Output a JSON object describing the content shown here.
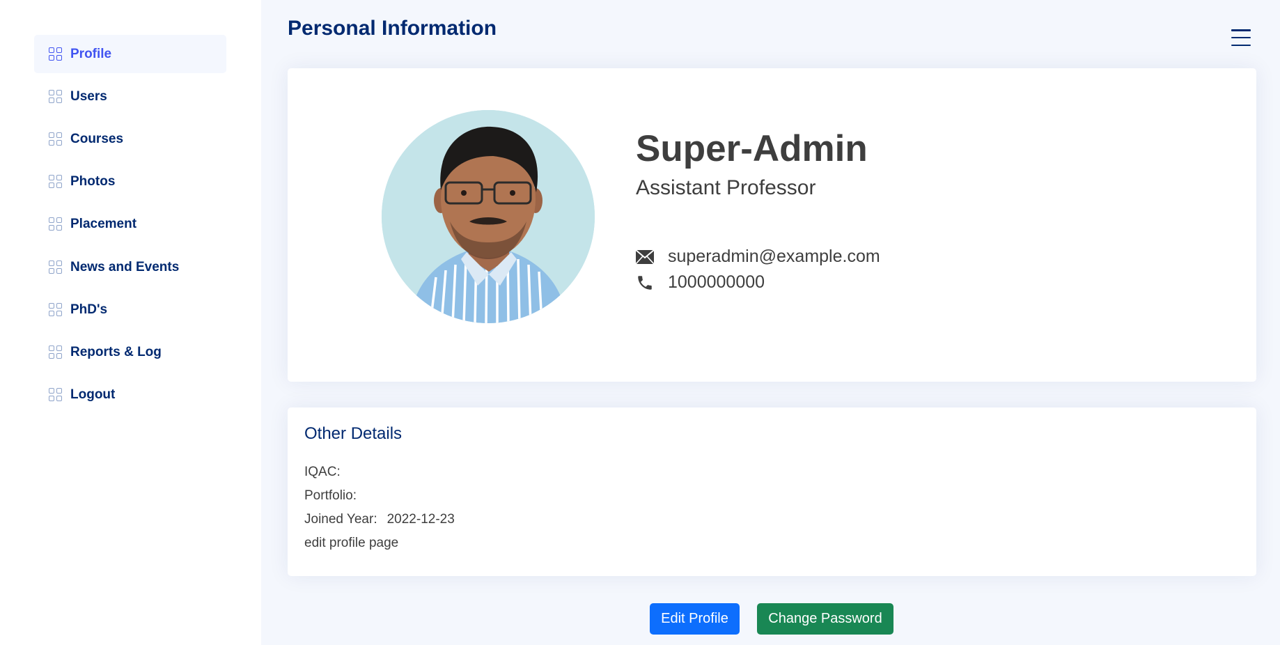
{
  "sidebar": {
    "items": [
      {
        "label": "Profile",
        "active": true
      },
      {
        "label": "Users"
      },
      {
        "label": "Courses"
      },
      {
        "label": "Photos"
      },
      {
        "label": "Placement"
      },
      {
        "label": "News and Events"
      },
      {
        "label": "PhD's"
      },
      {
        "label": "Reports & Log"
      },
      {
        "label": "Logout"
      }
    ],
    "item_icon": "grid-icon"
  },
  "header": {
    "title": "Personal Information",
    "menu_icon": "hamburger-menu-icon"
  },
  "profile": {
    "name": "Super-Admin",
    "role": "Assistant Professor",
    "email": "superadmin@example.com",
    "phone": "1000000000",
    "email_icon": "envelope-icon",
    "phone_icon": "phone-icon"
  },
  "details": {
    "title": "Other Details",
    "iqac_label": "IQAC:",
    "iqac_value": "",
    "portfolio_label": "Portfolio:",
    "portfolio_value": "",
    "joined_label": "Joined Year:",
    "joined_value": "2022-12-23",
    "note": "edit profile page"
  },
  "actions": {
    "edit_label": "Edit Profile",
    "password_label": "Change Password"
  },
  "colors": {
    "accent": "#4154f1",
    "navy": "#012970",
    "edit_button": "#0d6efd",
    "password_button": "#198754",
    "page_background": "#f4f7fd"
  }
}
